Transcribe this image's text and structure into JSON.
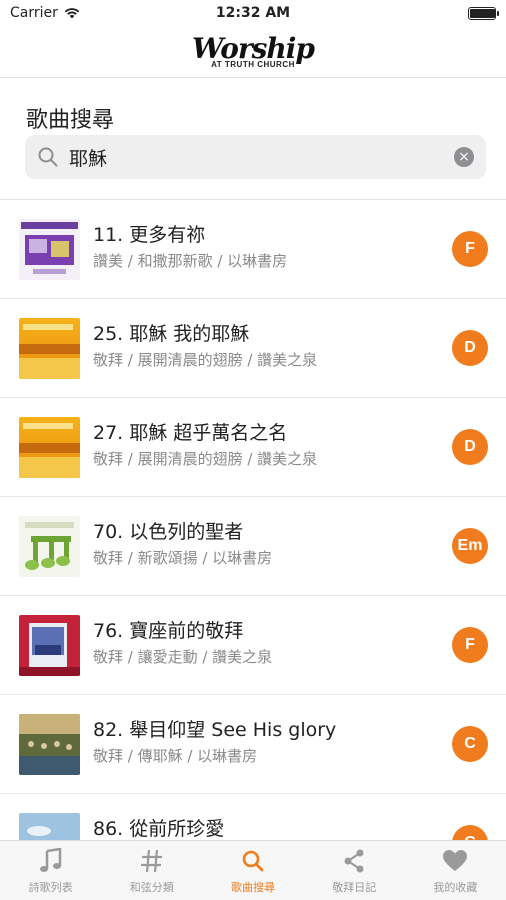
{
  "status_bar": {
    "carrier": "Carrier",
    "time": "12:32 AM",
    "battery_level": 0.95
  },
  "header": {
    "logo_main": "Worship",
    "logo_sub": "AT TRUTH CHURCH"
  },
  "search": {
    "title": "歌曲搜尋",
    "query": "耶穌",
    "clear_symbol": "×"
  },
  "songs": [
    {
      "title": "11. 更多有祢",
      "meta": "讚美 / 和撒那新歌 / 以琳書房",
      "key": "F",
      "thumb": "hosanna-gold-cover"
    },
    {
      "title": "25. 耶穌 我的耶穌",
      "meta": "敬拜 / 展開清晨的翅膀 / 讚美之泉",
      "key": "D",
      "thumb": "morning-wings-cover"
    },
    {
      "title": "27. 耶穌 超乎萬名之名",
      "meta": "敬拜 / 展開清晨的翅膀 / 讚美之泉",
      "key": "D",
      "thumb": "morning-wings-cover"
    },
    {
      "title": "70. 以色列的聖者",
      "meta": "敬拜 / 新歌頌揚 / 以琳書房",
      "key": "Em",
      "thumb": "green-notes-cover"
    },
    {
      "title": "76. 寶座前的敬拜",
      "meta": "敬拜 / 讓愛走動 / 讚美之泉",
      "key": "F",
      "thumb": "red-photo-cover"
    },
    {
      "title": "82. 舉目仰望 See His glory",
      "meta": "敬拜 / 傳耶穌 / 以琳書房",
      "key": "C",
      "thumb": "crowd-cover"
    },
    {
      "title": "86. 從前所珍愛",
      "meta": "",
      "key": "C",
      "thumb": "sky-cover"
    }
  ],
  "tabs": [
    {
      "label": "詩歌列表",
      "icon": "music-note-icon",
      "active": false
    },
    {
      "label": "和弦分類",
      "icon": "hash-icon",
      "active": false
    },
    {
      "label": "歌曲搜尋",
      "icon": "search-icon",
      "active": true
    },
    {
      "label": "敬拜日記",
      "icon": "share-icon",
      "active": false
    },
    {
      "label": "我的收藏",
      "icon": "heart-icon",
      "active": false
    }
  ],
  "colors": {
    "accent": "#f07c1e",
    "inactive": "#9a9a9a"
  }
}
